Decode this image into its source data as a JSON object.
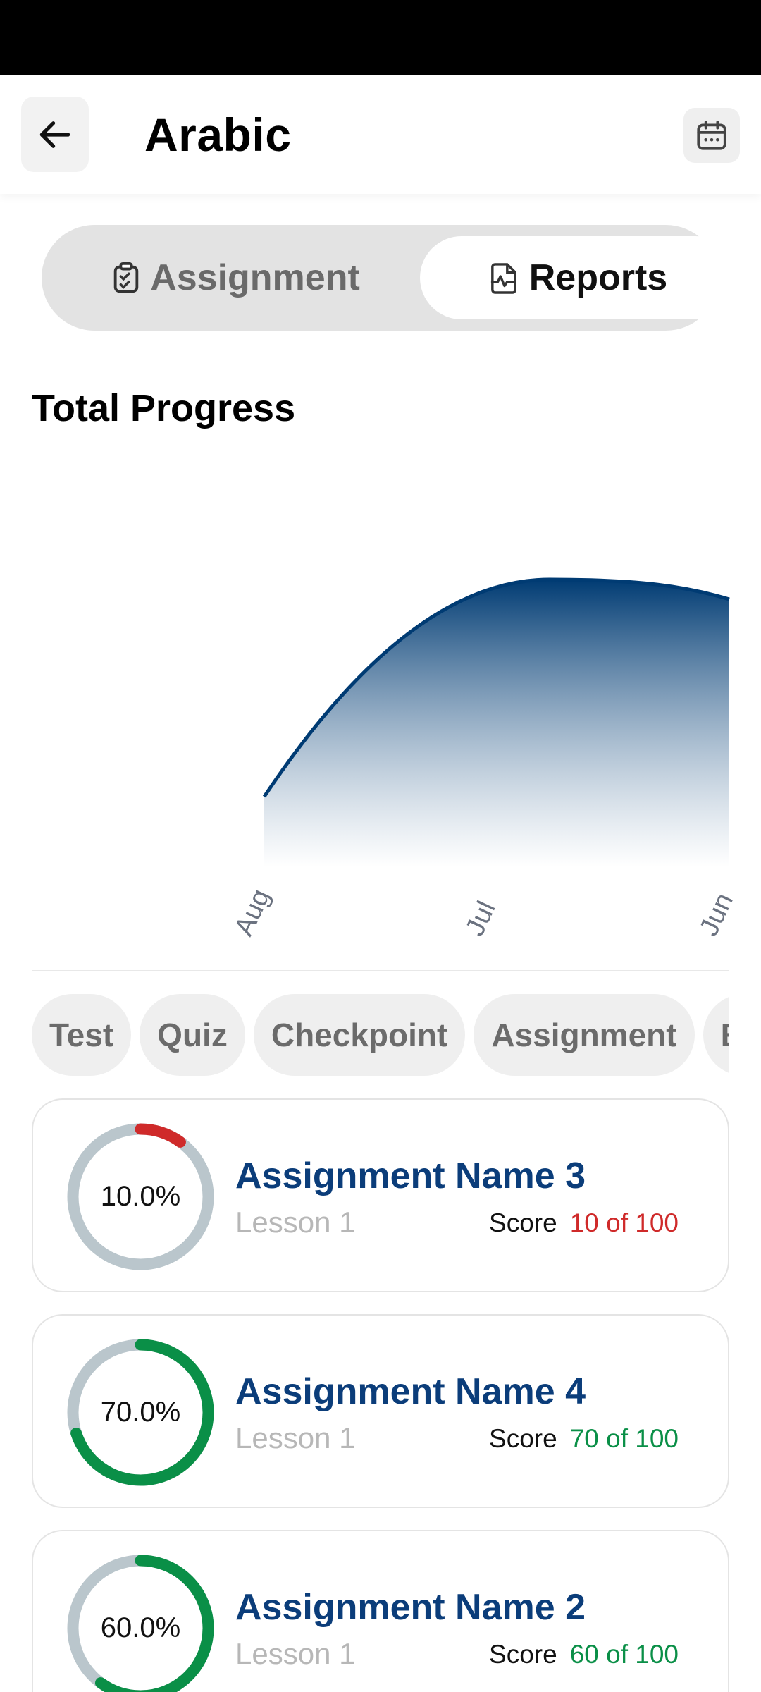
{
  "header": {
    "title": "Arabic",
    "back_icon": "arrow-left-icon",
    "calendar_icon": "calendar-icon"
  },
  "tabs": [
    {
      "label": "Assignment",
      "icon": "clipboard-check-icon",
      "selected": false
    },
    {
      "label": "Reports",
      "icon": "file-chart-icon",
      "selected": true
    }
  ],
  "section_title": "Total Progress",
  "chart_data": {
    "type": "area",
    "x": [
      "Aug",
      "Jul",
      "Jun"
    ],
    "series": [
      {
        "values": [
          20,
          95,
          90
        ]
      }
    ],
    "title": "",
    "xlabel": "",
    "ylabel": "",
    "grid": false,
    "colors": {
      "line": "#003b73",
      "fill_top": "#003b73",
      "fill_bottom": "#ffffff"
    }
  },
  "filters": [
    "Test",
    "Quiz",
    "Checkpoint",
    "Assignment",
    "Exam"
  ],
  "assignments": [
    {
      "name": "Assignment Name 3",
      "lesson": "Lesson 1",
      "score_label": "Score",
      "score": "10 of 100",
      "percent_text": "10.0%",
      "fraction": 0.1,
      "color": "#cf2a2a"
    },
    {
      "name": "Assignment Name 4",
      "lesson": "Lesson 1",
      "score_label": "Score",
      "score": "70 of 100",
      "percent_text": "70.0%",
      "fraction": 0.7,
      "color": "#0a8f47"
    },
    {
      "name": "Assignment Name 2",
      "lesson": "Lesson 1",
      "score_label": "Score",
      "score": "60 of 100",
      "percent_text": "60.0%",
      "fraction": 0.6,
      "color": "#0a8f47"
    }
  ],
  "colors": {
    "accent": "#003b73",
    "ring_track": "#bac6cc",
    "low": "#cf2a2a",
    "good": "#0a8f47"
  }
}
